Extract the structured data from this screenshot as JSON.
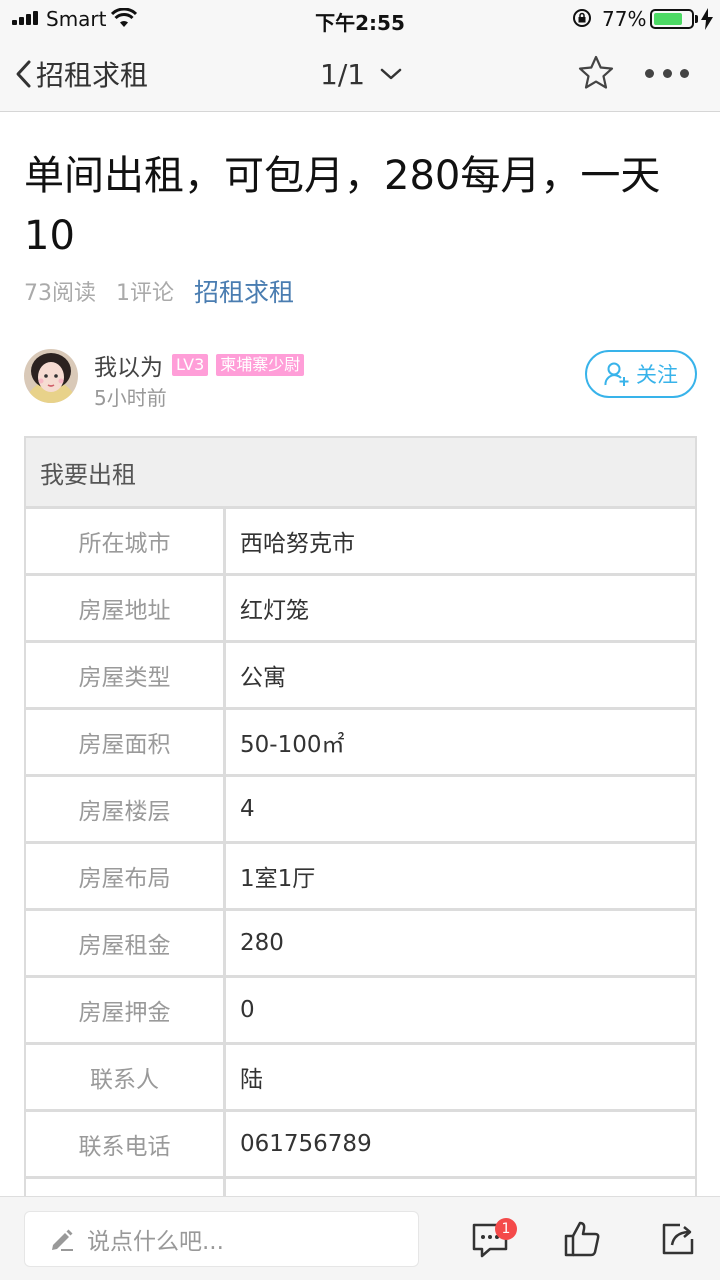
{
  "status_bar": {
    "carrier": "Smart",
    "time": "下午2:55",
    "battery_percent": "77%",
    "battery_level": 0.77
  },
  "nav": {
    "back_label": "招租求租",
    "pager": "1/1"
  },
  "post": {
    "title": "单间出租，可包月，280每月，一天10",
    "reads": "73阅读",
    "comments": "1评论",
    "category": "招租求租"
  },
  "author": {
    "name": "我以为",
    "level": "LV3",
    "rank": "柬埔寨少尉",
    "time": "5小时前",
    "follow_label": "关注"
  },
  "listing": {
    "header": "我要出租",
    "rows": [
      {
        "label": "所在城市",
        "value": "西哈努克市"
      },
      {
        "label": "房屋地址",
        "value": "红灯笼"
      },
      {
        "label": "房屋类型",
        "value": "公寓"
      },
      {
        "label": "房屋面积",
        "value": "50-100㎡"
      },
      {
        "label": "房屋楼层",
        "value": "4"
      },
      {
        "label": "房屋布局",
        "value": "1室1厅"
      },
      {
        "label": "房屋租金",
        "value": "280"
      },
      {
        "label": "房屋押金",
        "value": "0"
      },
      {
        "label": "联系人",
        "value": "陆"
      },
      {
        "label": "联系电话",
        "value": "061756789"
      },
      {
        "label": "",
        "value": ""
      }
    ]
  },
  "bottom_bar": {
    "comment_placeholder": "说点什么吧...",
    "comment_badge": "1"
  },
  "colors": {
    "accent": "#38b3ea",
    "category_link": "#4a7db1",
    "badge_pink": "#ff9ed8",
    "notification_red": "#f44a4a",
    "battery_green": "#4cd964"
  }
}
